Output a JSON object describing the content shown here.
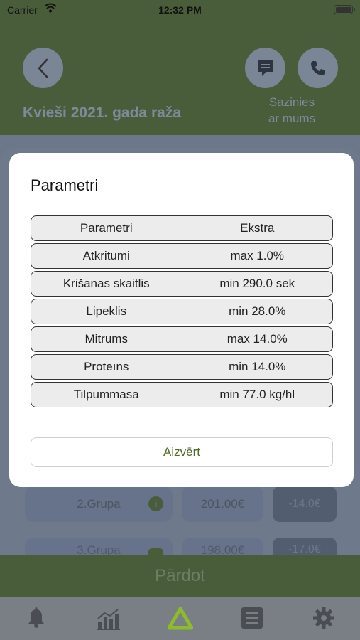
{
  "status_bar": {
    "carrier": "Carrier",
    "time": "12:32 PM"
  },
  "header": {
    "title": "Kvieši 2021. gada raža",
    "contact_line1": "Sazinies",
    "contact_line2": "ar mums"
  },
  "background_rows": [
    {
      "label": "2.Grupa",
      "price": "201.00€",
      "badge": "-14.0€"
    },
    {
      "label": "3.Grupa",
      "price": "198.00€",
      "badge": "-17.0€"
    }
  ],
  "sell_button": "Pārdot",
  "modal": {
    "title": "Parametri",
    "table": {
      "header": [
        "Parametri",
        "Ekstra"
      ],
      "rows": [
        [
          "Atkritumi",
          "max 1.0%"
        ],
        [
          "Krišanas skaitlis",
          "min 290.0 sek"
        ],
        [
          "Lipeklis",
          "min 28.0%"
        ],
        [
          "Mitrums",
          "max 14.0%"
        ],
        [
          "Proteīns",
          "min 14.0%"
        ],
        [
          "Tilpummasa",
          "min 77.0 kg/hl"
        ]
      ]
    },
    "close_label": "Aizvērt"
  },
  "tabs": [
    {
      "icon": "bell-icon"
    },
    {
      "icon": "chart-icon"
    },
    {
      "icon": "logo-icon"
    },
    {
      "icon": "list-icon"
    },
    {
      "icon": "gear-icon"
    }
  ],
  "colors": {
    "accent_green": "#4d6b22",
    "header_green": "#4a5d3b",
    "tab_active": "#8dbb2a"
  }
}
